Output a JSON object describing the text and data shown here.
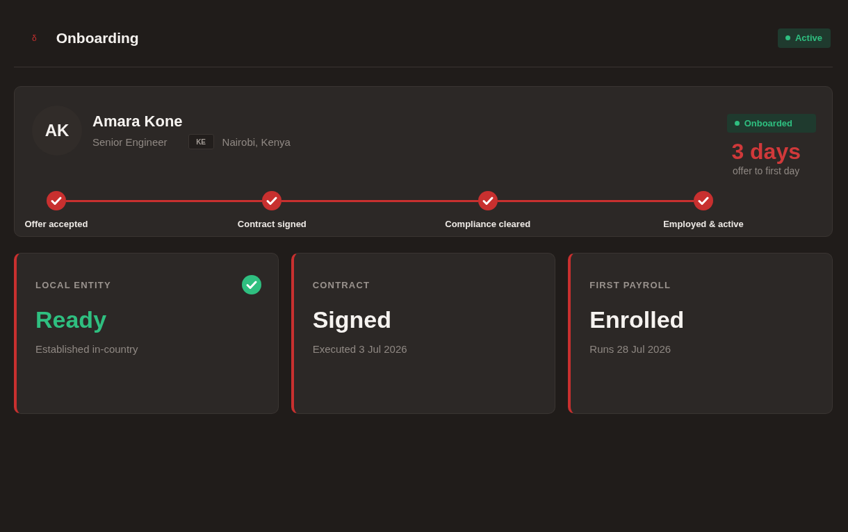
{
  "header": {
    "glyph": "δ",
    "title": "Onboarding",
    "status": {
      "label": "Active"
    }
  },
  "profile": {
    "initials": "AK",
    "name": "Amara Kone",
    "role": "Senior Engineer",
    "country_code": "KE",
    "location": "Nairobi, Kenya",
    "status": {
      "label": "Onboarded"
    },
    "duration": "3 days",
    "duration_caption": "offer to first day"
  },
  "steps": [
    {
      "label": "Offer accepted",
      "completed": true
    },
    {
      "label": "Contract signed",
      "completed": true
    },
    {
      "label": "Compliance cleared",
      "completed": true
    },
    {
      "label": "Employed & active",
      "completed": true
    }
  ],
  "cards": [
    {
      "label": "LOCAL ENTITY",
      "value": "Ready",
      "detail": "Established in-country",
      "verified": true
    },
    {
      "label": "CONTRACT",
      "value": "Signed",
      "detail": "Executed 3 Jul 2026",
      "verified": false
    },
    {
      "label": "FIRST PAYROLL",
      "value": "Enrolled",
      "detail": "Runs 28 Jul 2026",
      "verified": false
    }
  ]
}
